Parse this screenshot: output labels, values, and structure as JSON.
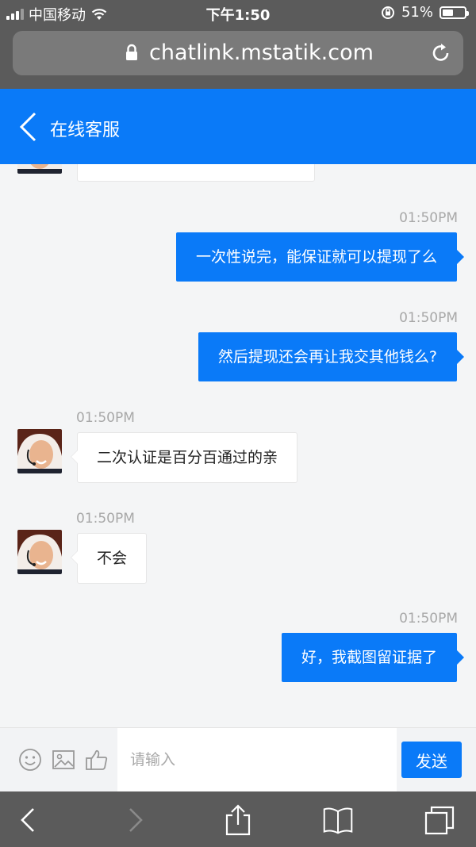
{
  "status_bar": {
    "carrier": "中国移动",
    "time": "下午1:50",
    "battery": "51%",
    "battery_level": 0.51
  },
  "browser": {
    "url": "chatlink.mstatik.com"
  },
  "header": {
    "title": "在线客服"
  },
  "messages": [
    {
      "from": "me",
      "time": "01:50PM",
      "text": "一次性说完，能保证就可以提现了么"
    },
    {
      "from": "me",
      "time": "01:50PM",
      "text": "然后提现还会再让我交其他钱么?"
    },
    {
      "from": "agent",
      "time": "01:50PM",
      "text": "二次认证是百分百通过的亲"
    },
    {
      "from": "agent",
      "time": "01:50PM",
      "text": "不会"
    },
    {
      "from": "me",
      "time": "01:50PM",
      "text": "好，我截图留证据了"
    }
  ],
  "input": {
    "placeholder": "请输入",
    "value": "",
    "send_label": "发送"
  },
  "icons": {
    "emoji": "smiley-icon",
    "image": "image-icon",
    "like": "thumbs-up-icon",
    "back": "chevron-left-icon",
    "forward": "chevron-right-icon",
    "share": "share-icon",
    "bookmarks": "book-icon",
    "tabs": "tabs-icon"
  },
  "colors": {
    "accent": "#0a7af8",
    "browser_chrome": "#5b5b5b",
    "timestamp": "#a8a8a8"
  }
}
